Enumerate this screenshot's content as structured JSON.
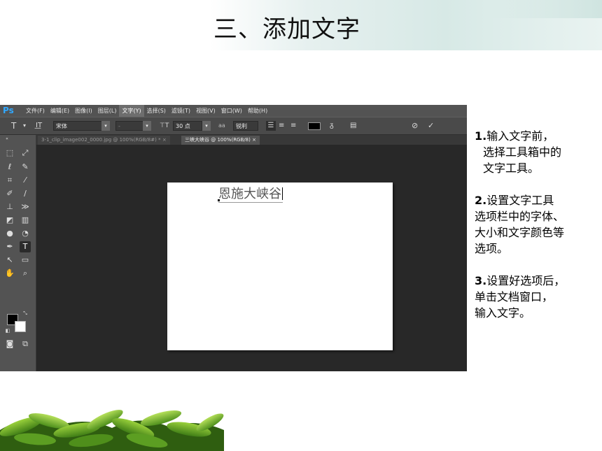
{
  "slide": {
    "title": "三、添加文字"
  },
  "app": {
    "logo": "Ps",
    "menu": [
      {
        "label": "文件(F)",
        "active": false
      },
      {
        "label": "编辑(E)",
        "active": false
      },
      {
        "label": "图像(I)",
        "active": false
      },
      {
        "label": "图层(L)",
        "active": false
      },
      {
        "label": "文字(Y)",
        "active": true
      },
      {
        "label": "选择(S)",
        "active": false
      },
      {
        "label": "滤镜(T)",
        "active": false
      },
      {
        "label": "视图(V)",
        "active": false
      },
      {
        "label": "窗口(W)",
        "active": false
      },
      {
        "label": "帮助(H)",
        "active": false
      }
    ],
    "options": {
      "tool_icon": "T",
      "font_family": "宋体",
      "font_style": "-",
      "font_size": "30 点",
      "aa_label": "aa",
      "antialias": "锐利"
    },
    "tabs": [
      {
        "label": "3-1_clip_image002_0000.jpg @ 100%(RGB/8#) *",
        "active": false
      },
      {
        "label": "三峡大峡谷 @ 100%(RGB/8) ",
        "active": true
      }
    ],
    "canvas_text": "恩施大峡谷",
    "active_tool": "type-tool"
  },
  "steps": {
    "s1_num": "1.",
    "s1_line1": "输入文字前，",
    "s1_line2": "选择工具箱中的",
    "s1_line3": "文字工具。",
    "s2_num": "2.",
    "s2_line1": "设置文字工具",
    "s2_line2": "选项栏中的字体、",
    "s2_line3": "大小和文字颜色等",
    "s2_line4": "选项。",
    "s3_num": "3.",
    "s3_line1": "设置好选项后，",
    "s3_line2": "单击文档窗口，",
    "s3_line3": "输入文字。"
  },
  "colors": {
    "ps_blue": "#31a8ff",
    "text_color": "#000000"
  }
}
